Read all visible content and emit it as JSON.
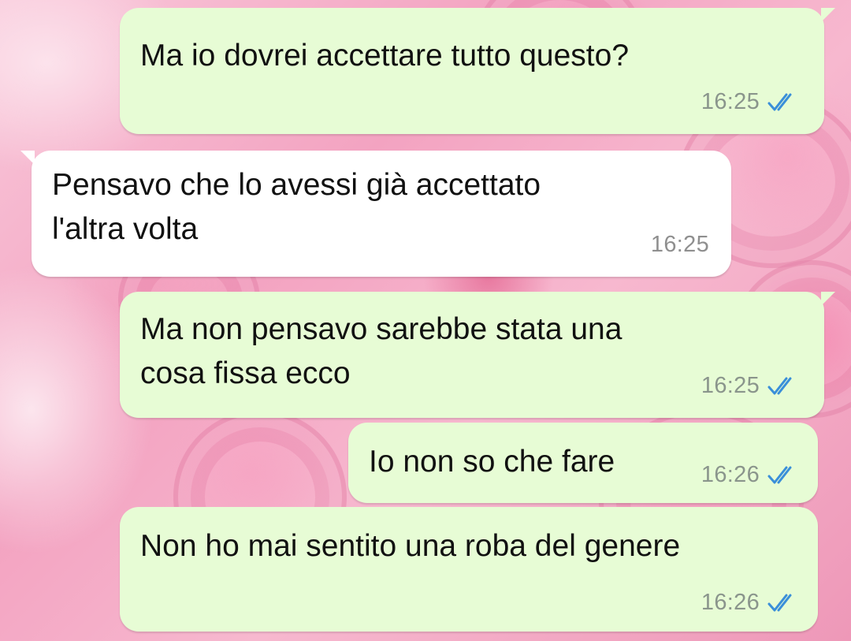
{
  "chat": {
    "messages": [
      {
        "direction": "outgoing",
        "text": "Ma io dovrei accettare tutto questo?",
        "time": "16:25",
        "status_icon": "double-check-read-icon"
      },
      {
        "direction": "incoming",
        "text": "Pensavo che lo avessi già accettato\nl'altra volta",
        "time": "16:25"
      },
      {
        "direction": "outgoing",
        "text": "Ma non pensavo sarebbe stata una\ncosa fissa ecco",
        "time": "16:25",
        "status_icon": "double-check-read-icon"
      },
      {
        "direction": "outgoing",
        "text": "Io non so che fare",
        "time": "16:26",
        "status_icon": "double-check-read-icon"
      },
      {
        "direction": "outgoing",
        "text": "Non ho mai sentito una roba del genere",
        "time": "16:26",
        "status_icon": "double-check-read-icon"
      }
    ]
  },
  "colors": {
    "outgoing_bubble": "#e7fcd5",
    "incoming_bubble": "#ffffff",
    "read_ticks": "#3a8fd9",
    "timestamp": "#8a958c"
  }
}
